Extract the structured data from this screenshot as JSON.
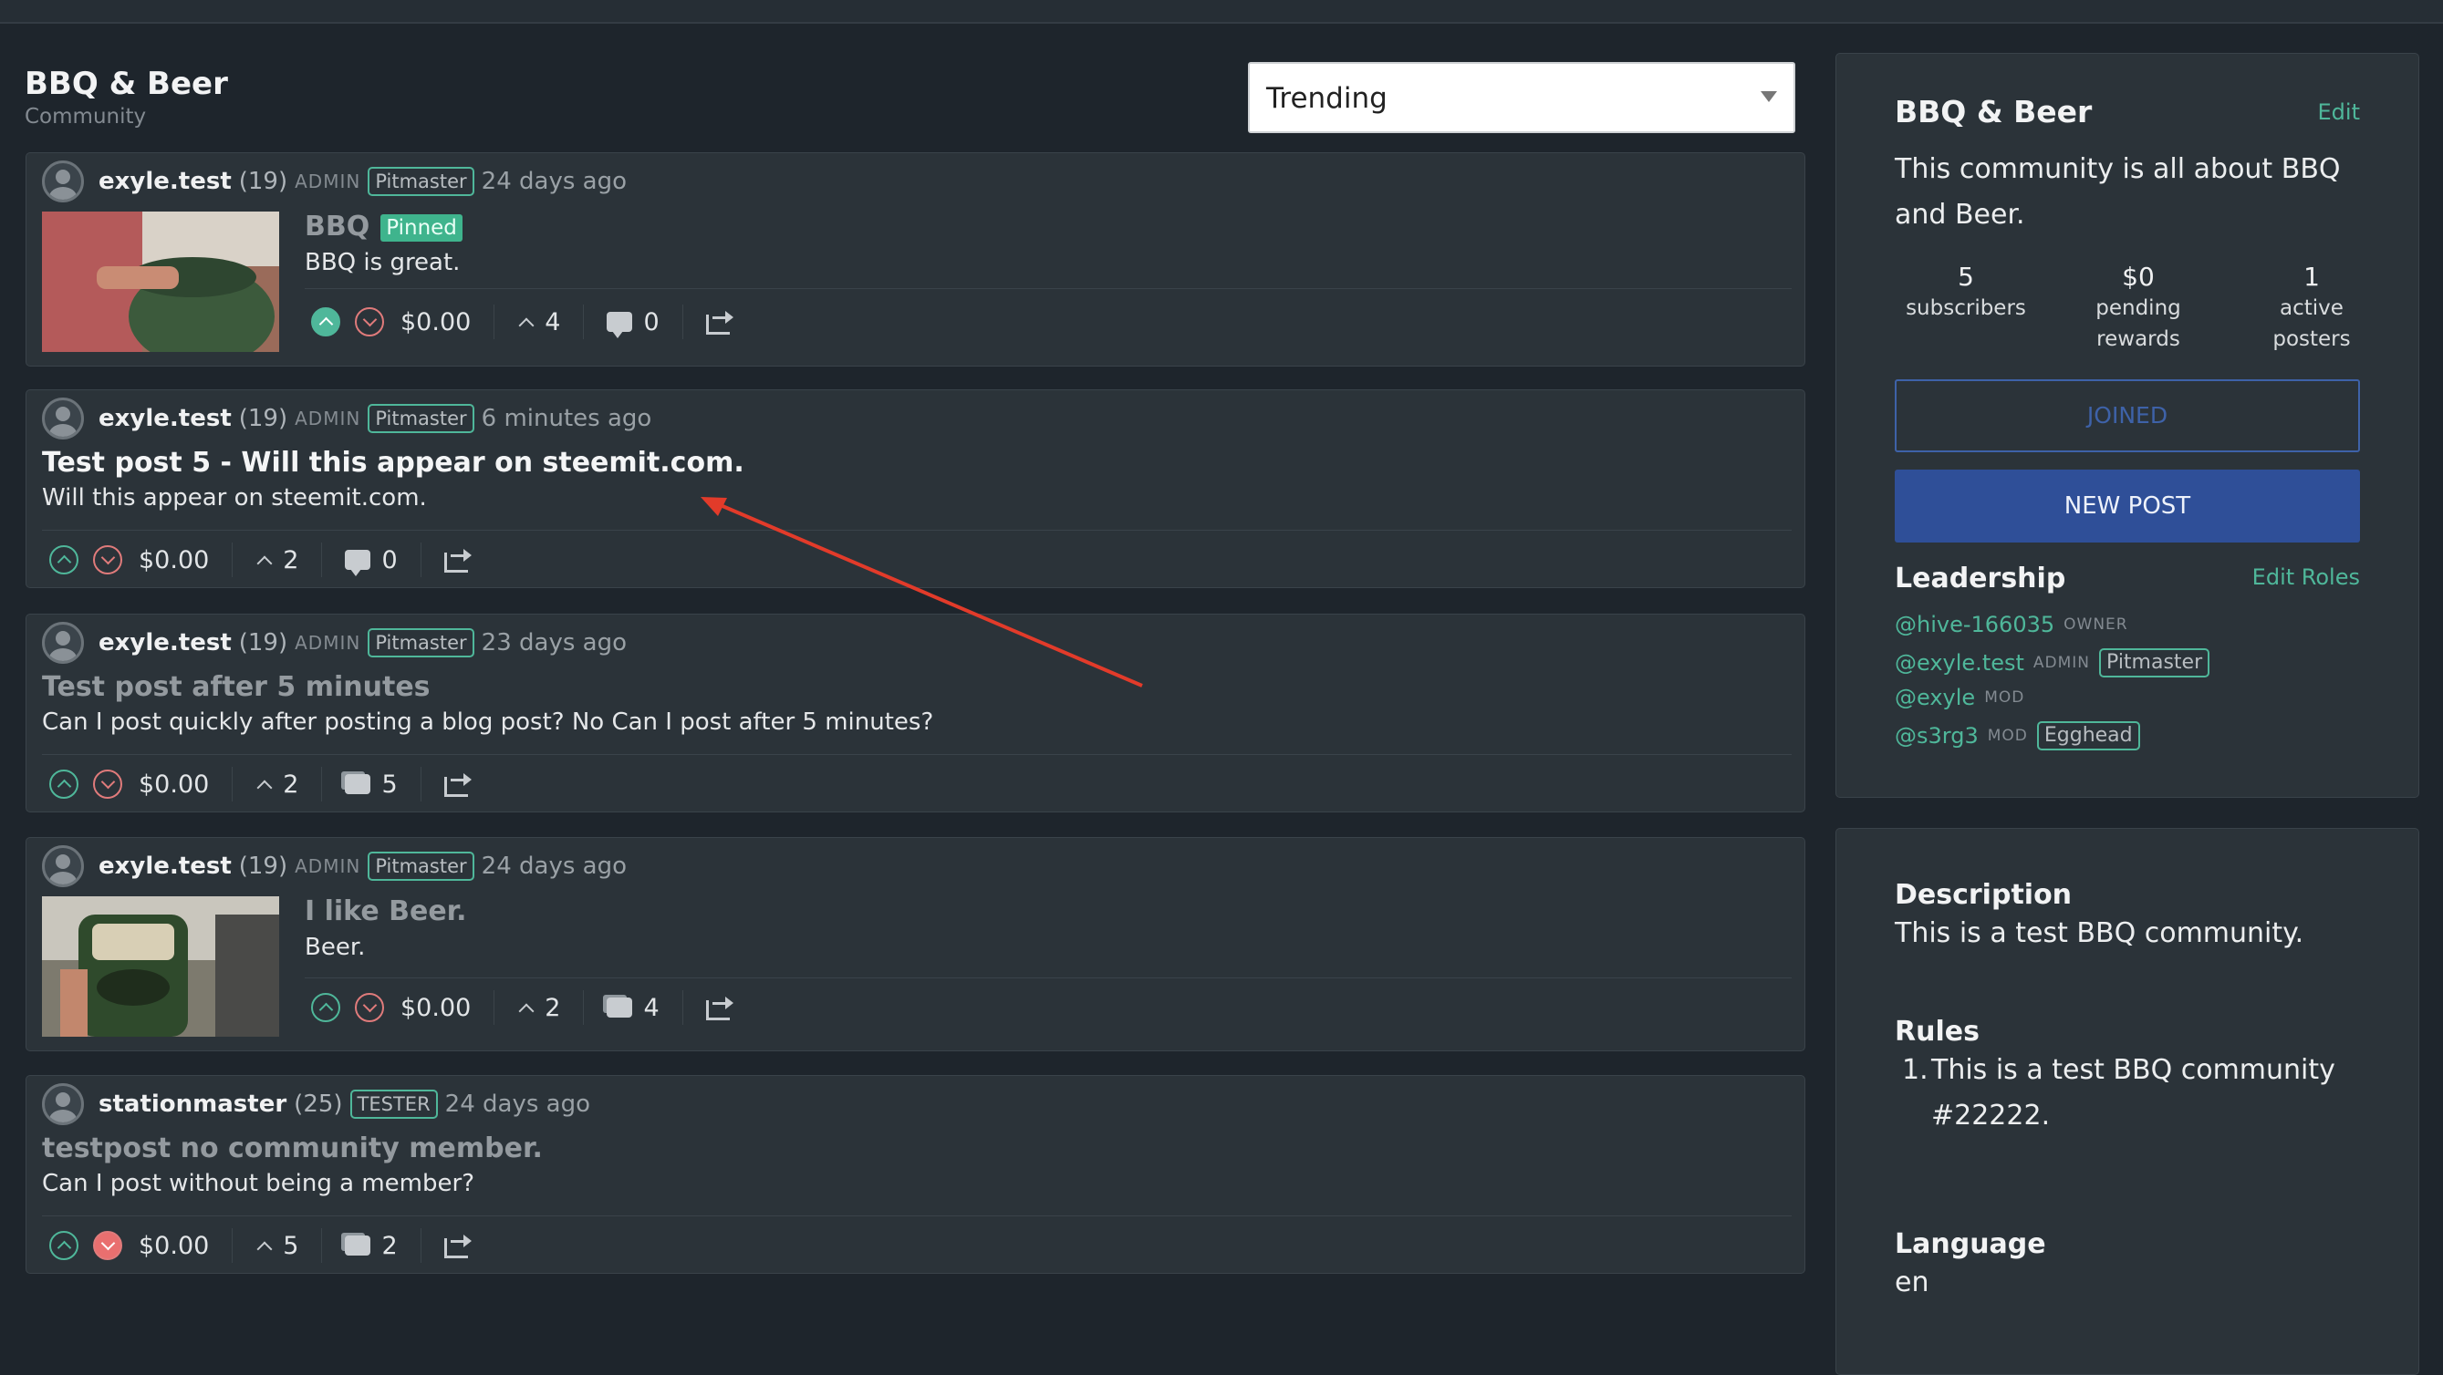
{
  "community": {
    "title": "BBQ & Beer",
    "subtitle": "Community"
  },
  "sort": {
    "selected": "Trending"
  },
  "posts": [
    {
      "author": "exyle.test",
      "rep": "(19)",
      "role": "ADMIN",
      "badge": "Pitmaster",
      "time": "24 days ago",
      "title": "BBQ",
      "pinned": "Pinned",
      "body": "BBQ is great.",
      "payout": "$0.00",
      "votes": "4",
      "comments": "0"
    },
    {
      "author": "exyle.test",
      "rep": "(19)",
      "role": "ADMIN",
      "badge": "Pitmaster",
      "time": "6 minutes ago",
      "title": "Test post 5 - Will this appear on steemit.com.",
      "body": "Will this appear on steemit.com.",
      "payout": "$0.00",
      "votes": "2",
      "comments": "0"
    },
    {
      "author": "exyle.test",
      "rep": "(19)",
      "role": "ADMIN",
      "badge": "Pitmaster",
      "time": "23 days ago",
      "title": "Test post after 5 minutes",
      "body": "Can I post quickly after posting a blog post? No Can I post after 5 minutes?",
      "payout": "$0.00",
      "votes": "2",
      "comments": "5"
    },
    {
      "author": "exyle.test",
      "rep": "(19)",
      "role": "ADMIN",
      "badge": "Pitmaster",
      "time": "24 days ago",
      "title": "I like Beer.",
      "body": "Beer.",
      "payout": "$0.00",
      "votes": "2",
      "comments": "4"
    },
    {
      "author": "stationmaster",
      "rep": "(25)",
      "badge": "TESTER",
      "time": "24 days ago",
      "title": "testpost no community member.",
      "body": "Can I post without being a member?",
      "payout": "$0.00",
      "votes": "5",
      "comments": "2"
    }
  ],
  "sidebar": {
    "title": "BBQ & Beer",
    "edit": "Edit",
    "about": "This community is all about BBQ and Beer.",
    "stats": [
      {
        "num": "5",
        "label1": "subscribers",
        "label2": ""
      },
      {
        "num": "$0",
        "label1": "pending",
        "label2": "rewards"
      },
      {
        "num": "1",
        "label1": "active",
        "label2": "posters"
      }
    ],
    "joined": "JOINED",
    "new_post": "NEW POST",
    "leadership_title": "Leadership",
    "edit_roles": "Edit Roles",
    "leaders": [
      {
        "name": "@hive-166035",
        "role": "OWNER",
        "badge": ""
      },
      {
        "name": "@exyle.test",
        "role": "ADMIN",
        "badge": "Pitmaster"
      },
      {
        "name": "@exyle",
        "role": "MOD",
        "badge": ""
      },
      {
        "name": "@s3rg3",
        "role": "MOD",
        "badge": "Egghead"
      }
    ],
    "description_title": "Description",
    "description": "This is a test BBQ community.",
    "rules_title": "Rules",
    "rules": [
      {
        "n": "1.",
        "text": "This is a test BBQ community #22222."
      }
    ],
    "language_title": "Language",
    "language": "en"
  },
  "colors": {
    "accent": "#4fb79a",
    "downvote": "#e07b7b",
    "primary_button": "#2f4f98",
    "annotation_arrow": "#e23b2a"
  }
}
